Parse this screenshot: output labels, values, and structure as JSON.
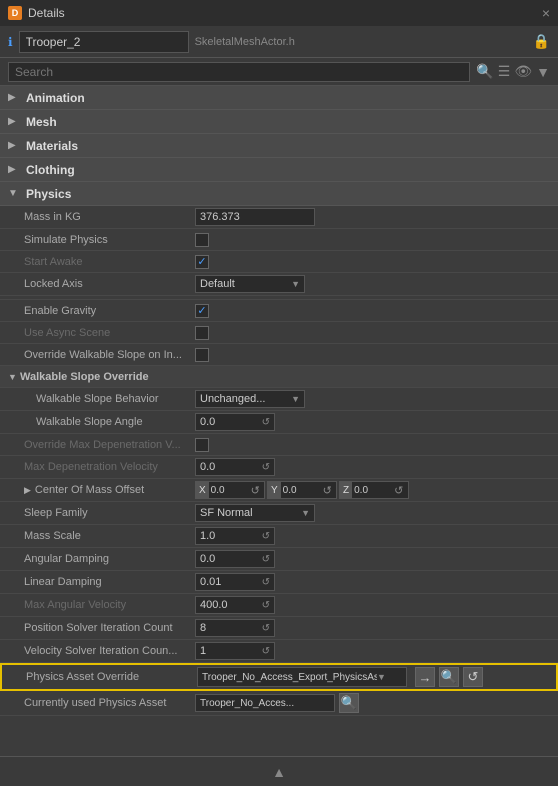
{
  "titleBar": {
    "icon": "D",
    "title": "Details",
    "closeLabel": "×"
  },
  "actorHeader": {
    "name": "Trooper_2",
    "class": "SkeletalMeshActor.h",
    "lockIcon": "🔒"
  },
  "search": {
    "placeholder": "Search"
  },
  "sections": [
    {
      "label": "Animation",
      "expanded": false,
      "arrow": "▶"
    },
    {
      "label": "Mesh",
      "expanded": false,
      "arrow": "▶"
    },
    {
      "label": "Materials",
      "expanded": false,
      "arrow": "▶"
    },
    {
      "label": "Clothing",
      "expanded": false,
      "arrow": "▶"
    },
    {
      "label": "Physics",
      "expanded": true,
      "arrow": "▼"
    }
  ],
  "physics": {
    "fields": [
      {
        "label": "Mass in KG",
        "value": "376.373",
        "type": "text",
        "disabled": false
      },
      {
        "label": "Simulate Physics",
        "value": false,
        "type": "checkbox",
        "disabled": false
      },
      {
        "label": "Start Awake",
        "value": true,
        "type": "checkbox",
        "disabled": true
      },
      {
        "label": "Locked Axis",
        "value": "Default",
        "type": "dropdown",
        "disabled": false
      },
      {
        "label": "Enable Gravity",
        "value": true,
        "type": "checkbox",
        "disabled": false
      },
      {
        "label": "Use Async Scene",
        "value": false,
        "type": "checkbox",
        "disabled": true
      },
      {
        "label": "Override Walkable Slope on In...",
        "value": false,
        "type": "checkbox",
        "disabled": false
      }
    ],
    "walkableSlopeOverride": {
      "label": "Walkable Slope Override",
      "expanded": true,
      "arrow": "▼",
      "fields": [
        {
          "label": "Walkable Slope Behavior",
          "value": "Unchanged...",
          "type": "dropdown"
        },
        {
          "label": "Walkable Slope Angle",
          "value": "0.0",
          "type": "numfield"
        }
      ]
    },
    "fields2": [
      {
        "label": "Override Max Depenetration V...",
        "value": false,
        "type": "checkbox",
        "disabled": true
      },
      {
        "label": "Max Depenetration Velocity",
        "value": "0.0",
        "type": "numfield",
        "disabled": true
      }
    ],
    "centerOfMassOffset": {
      "label": "Center Of Mass Offset",
      "x": "0.0",
      "y": "0.0",
      "z": "0.0"
    },
    "fields3": [
      {
        "label": "Sleep Family",
        "value": "SF Normal",
        "type": "dropdown"
      },
      {
        "label": "Mass Scale",
        "value": "1.0",
        "type": "numfield"
      },
      {
        "label": "Angular Damping",
        "value": "0.0",
        "type": "numfield"
      },
      {
        "label": "Linear Damping",
        "value": "0.01",
        "type": "numfield"
      },
      {
        "label": "Max Angular Velocity",
        "value": "400.0",
        "type": "numfield",
        "disabled": true
      },
      {
        "label": "Position Solver Iteration Count",
        "value": "8",
        "type": "numfield"
      },
      {
        "label": "Velocity Solver Iteration Coun...",
        "value": "1",
        "type": "numfield"
      }
    ],
    "physicsAssetOverride": {
      "label": "Physics Asset Override",
      "value": "Trooper_No_Access_Export_PhysicsAsset",
      "highlighted": true
    },
    "currentlyUsedPhysicsAsset": {
      "label": "Currently used Physics Asset",
      "value": "Trooper_No_Acces..."
    }
  },
  "icons": {
    "search": "🔍",
    "list": "☰",
    "eye": "👁",
    "reset": "↺",
    "arrow_right": "→",
    "arrow_down": "↓",
    "expand": "▲"
  }
}
